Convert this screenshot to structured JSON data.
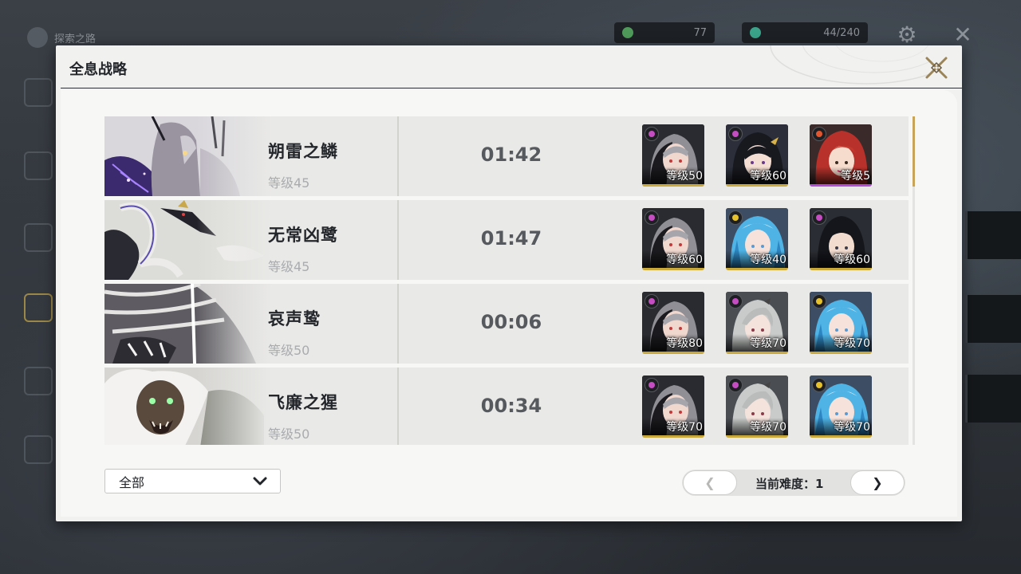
{
  "background": {
    "title": "探索之路",
    "currency_1": "77",
    "currency_2": "44/240"
  },
  "dialog": {
    "title": "全息战略"
  },
  "records": [
    {
      "boss_name": "朔雷之鳞",
      "boss_level": "等级45",
      "time": "01:42",
      "team": [
        {
          "level": "等级50",
          "element": "purple",
          "rarity": "gold"
        },
        {
          "level": "等级60",
          "element": "purple",
          "rarity": "gold"
        },
        {
          "level": "等级5",
          "element": "red",
          "rarity": "purple"
        }
      ]
    },
    {
      "boss_name": "无常凶鹭",
      "boss_level": "等级45",
      "time": "01:47",
      "team": [
        {
          "level": "等级60",
          "element": "purple",
          "rarity": "gold"
        },
        {
          "level": "等级40",
          "element": "yellow",
          "rarity": "gold"
        },
        {
          "level": "等级60",
          "element": "purple",
          "rarity": "gold"
        }
      ]
    },
    {
      "boss_name": "哀声鸷",
      "boss_level": "等级50",
      "time": "00:06",
      "team": [
        {
          "level": "等级80",
          "element": "purple",
          "rarity": "gold"
        },
        {
          "level": "等级70",
          "element": "purple",
          "rarity": "gold"
        },
        {
          "level": "等级70",
          "element": "yellow",
          "rarity": "gold"
        }
      ]
    },
    {
      "boss_name": "飞廉之猩",
      "boss_level": "等级50",
      "time": "00:34",
      "team": [
        {
          "level": "等级70",
          "element": "purple",
          "rarity": "gold"
        },
        {
          "level": "等级70",
          "element": "purple",
          "rarity": "gold"
        },
        {
          "level": "等级70",
          "element": "yellow",
          "rarity": "gold"
        }
      ]
    }
  ],
  "filter": {
    "selected": "全部"
  },
  "pager": {
    "prev": "❮",
    "next": "❯",
    "label": "当前难度：1"
  },
  "colors": {
    "accent_gold": "#c9a93c",
    "rarity_purple": "#b04fd6",
    "element_purple": "#c44dc2",
    "element_yellow": "#e6c12e",
    "element_red": "#e0562e"
  }
}
